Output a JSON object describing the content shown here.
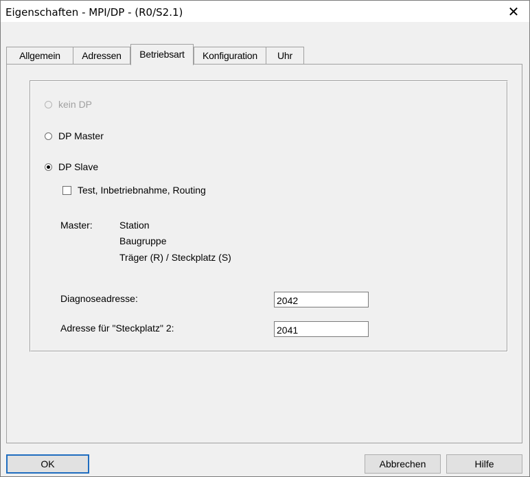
{
  "window": {
    "title": "Eigenschaften - MPI/DP - (R0/S2.1)",
    "close_glyph": "✕"
  },
  "tabs": [
    {
      "label": "Allgemein",
      "active": false
    },
    {
      "label": "Adressen",
      "active": false
    },
    {
      "label": "Betriebsart",
      "active": true
    },
    {
      "label": "Konfiguration",
      "active": false
    },
    {
      "label": "Uhr",
      "active": false
    }
  ],
  "mode": {
    "options": [
      {
        "label": "kein DP",
        "selected": false,
        "enabled": false
      },
      {
        "label": "DP Master",
        "selected": false,
        "enabled": true
      },
      {
        "label": "DP Slave",
        "selected": true,
        "enabled": true
      }
    ],
    "test_checkbox": {
      "label": "Test, Inbetriebnahme, Routing",
      "checked": false
    },
    "master_label": "Master:",
    "master_lines": [
      "Station",
      "Baugruppe",
      "Träger (R) / Steckplatz (S)"
    ],
    "diag_label": "Diagnoseadresse:",
    "diag_value": "2042",
    "slot_label": "Adresse für \"Steckplatz\" 2:",
    "slot_value": "2041"
  },
  "buttons": {
    "ok": "OK",
    "cancel": "Abbrechen",
    "help": "Hilfe"
  }
}
